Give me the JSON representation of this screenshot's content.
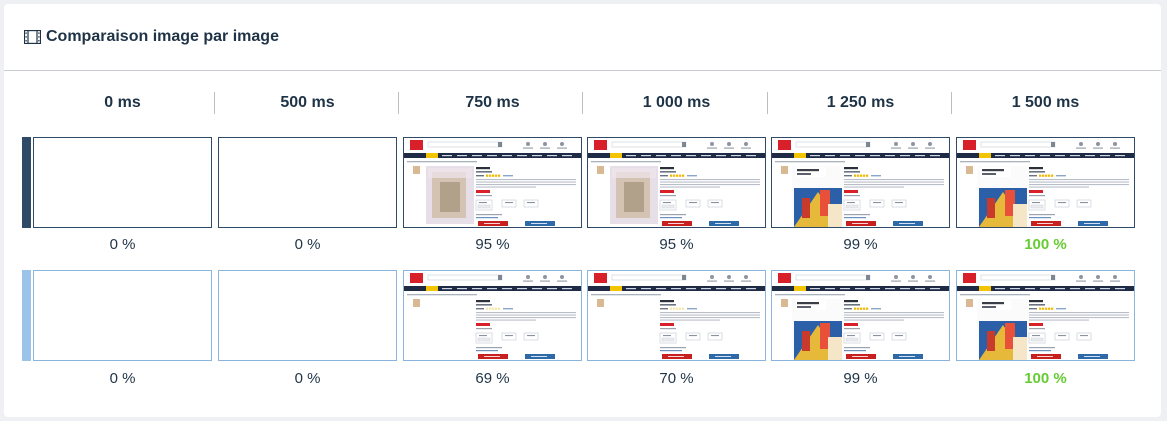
{
  "header": {
    "title": "Comparaison image par image",
    "icon": "film-icon"
  },
  "columns": [
    "0 ms",
    "500 ms",
    "750 ms",
    "1 000 ms",
    "1 250 ms",
    "1 500 ms"
  ],
  "rows": [
    {
      "bar_color": "#2f4a66",
      "frame_border": "#2f4a66",
      "frames": [
        {
          "state": "blank",
          "percent": "0 %"
        },
        {
          "state": "blank",
          "percent": "0 %"
        },
        {
          "state": "blurred-image",
          "percent": "95 %"
        },
        {
          "state": "blurred-image",
          "percent": "95 %"
        },
        {
          "state": "full-image",
          "percent": "99 %"
        },
        {
          "state": "full-image",
          "percent": "100 %",
          "best": true
        }
      ]
    },
    {
      "bar_color": "#9cc3e8",
      "frame_border": "#8ab4dc",
      "frames": [
        {
          "state": "blank",
          "percent": "0 %"
        },
        {
          "state": "blank",
          "percent": "0 %"
        },
        {
          "state": "no-image",
          "percent": "69 %"
        },
        {
          "state": "no-image",
          "percent": "70 %"
        },
        {
          "state": "full-image",
          "percent": "99 %"
        },
        {
          "state": "full-image",
          "percent": "100 %",
          "best": true
        }
      ]
    }
  ],
  "colors": {
    "best": "#66cc33",
    "text": "#1f3347",
    "brand_red": "#d8202a",
    "nav_dark": "#1f2a44",
    "nav_yellow": "#f2c500",
    "cta_red": "#c8201f",
    "cta_blue": "#2e6aa8"
  }
}
